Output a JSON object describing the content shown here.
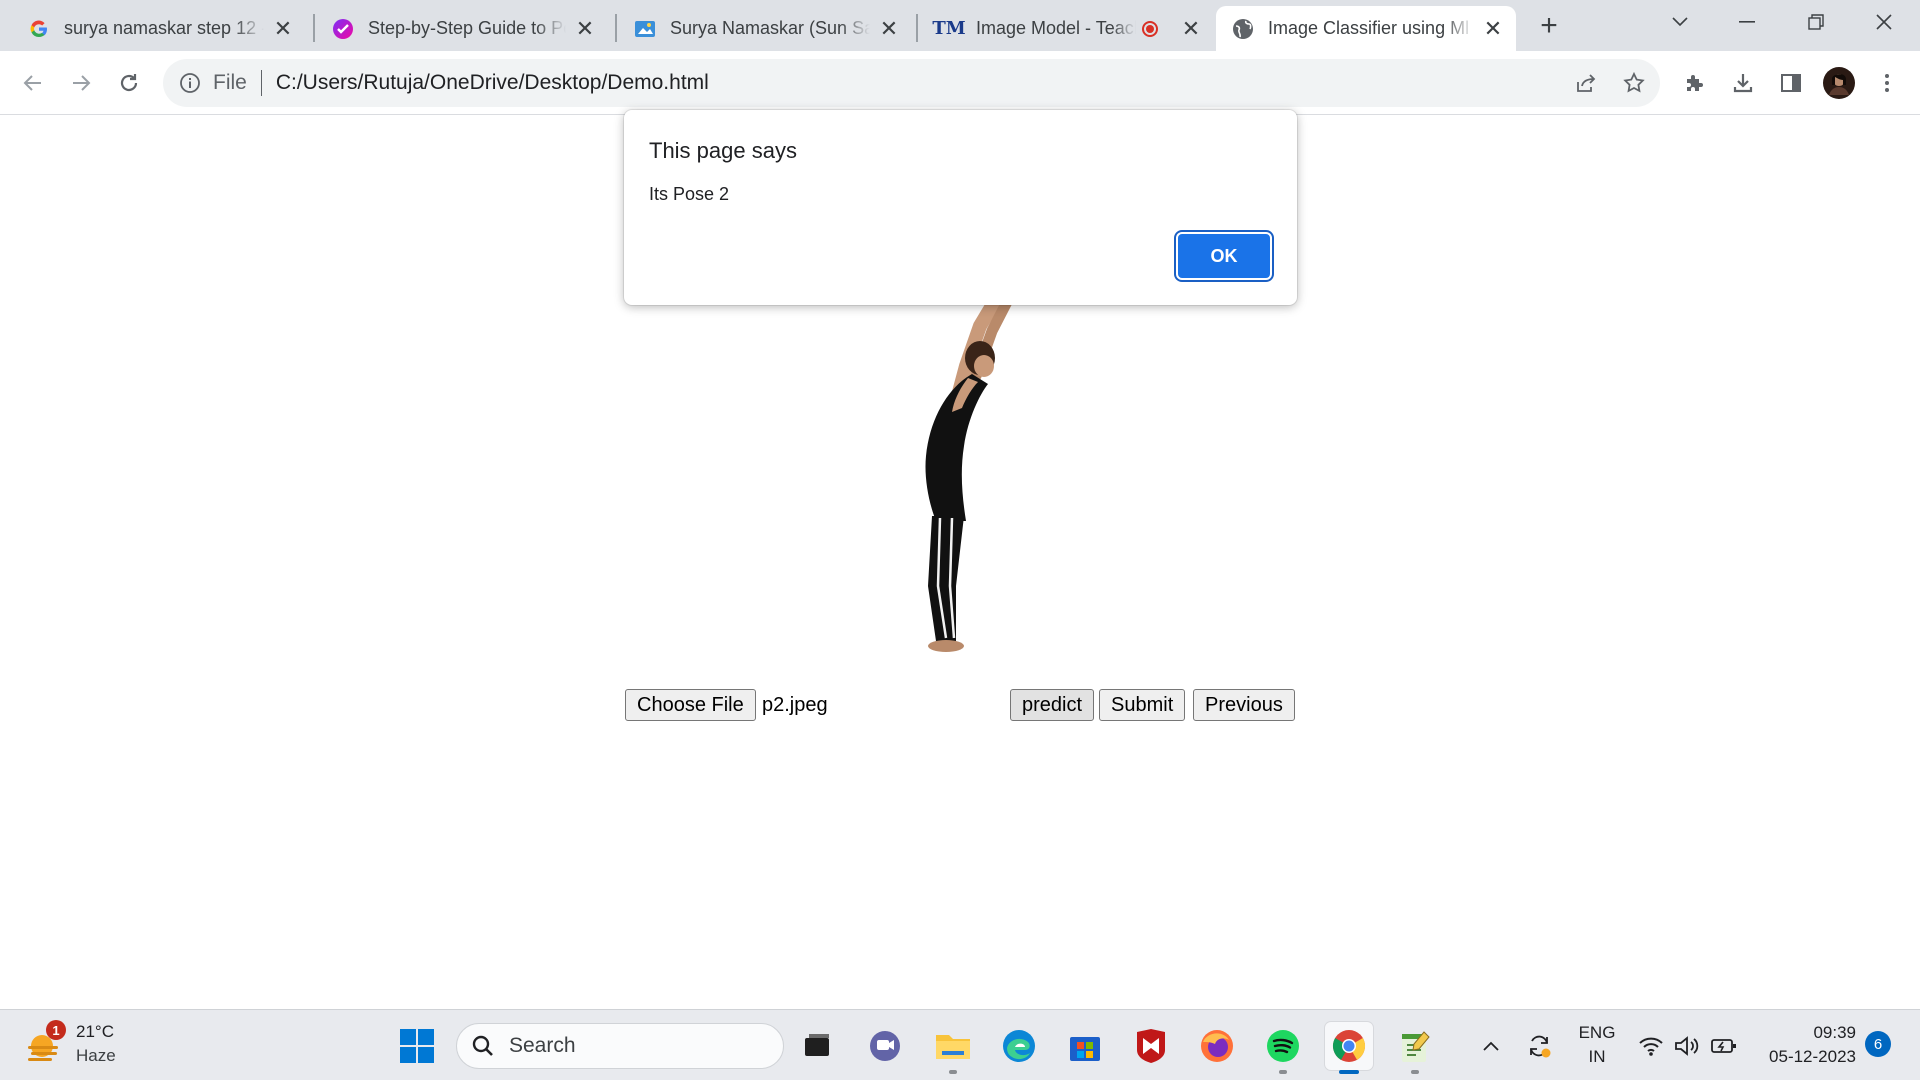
{
  "browser": {
    "tabs": [
      {
        "title": "surya namaskar step 12 -",
        "favicon": "google-icon"
      },
      {
        "title": "Step-by-Step Guide to Pe",
        "favicon": "guide-icon"
      },
      {
        "title": "Surya Namaskar (Sun Sal",
        "favicon": "site-icon"
      },
      {
        "title": "Image Model - Teach",
        "favicon": "teachable-machine-icon",
        "recording": true
      },
      {
        "title": "Image Classifier using Ml",
        "favicon": "globe-icon",
        "active": true
      }
    ],
    "address": {
      "scheme_label": "File",
      "url": "C:/Users/Rutuja/OneDrive/Desktop/Demo.html"
    }
  },
  "dialog": {
    "heading": "This page says",
    "message": "Its Pose 2",
    "ok_label": "OK"
  },
  "page": {
    "choose_file_label": "Choose File",
    "file_name": "p2.jpeg",
    "predict_label": "predict",
    "submit_label": "Submit",
    "previous_label": "Previous"
  },
  "taskbar": {
    "weather": {
      "temp": "21°C",
      "condition": "Haze",
      "badge": "1"
    },
    "search_label": "Search",
    "language": {
      "line1": "ENG",
      "line2": "IN"
    },
    "clock": {
      "time": "09:39",
      "date": "05-12-2023"
    },
    "notifications": "6",
    "accent": "#0067c0"
  }
}
